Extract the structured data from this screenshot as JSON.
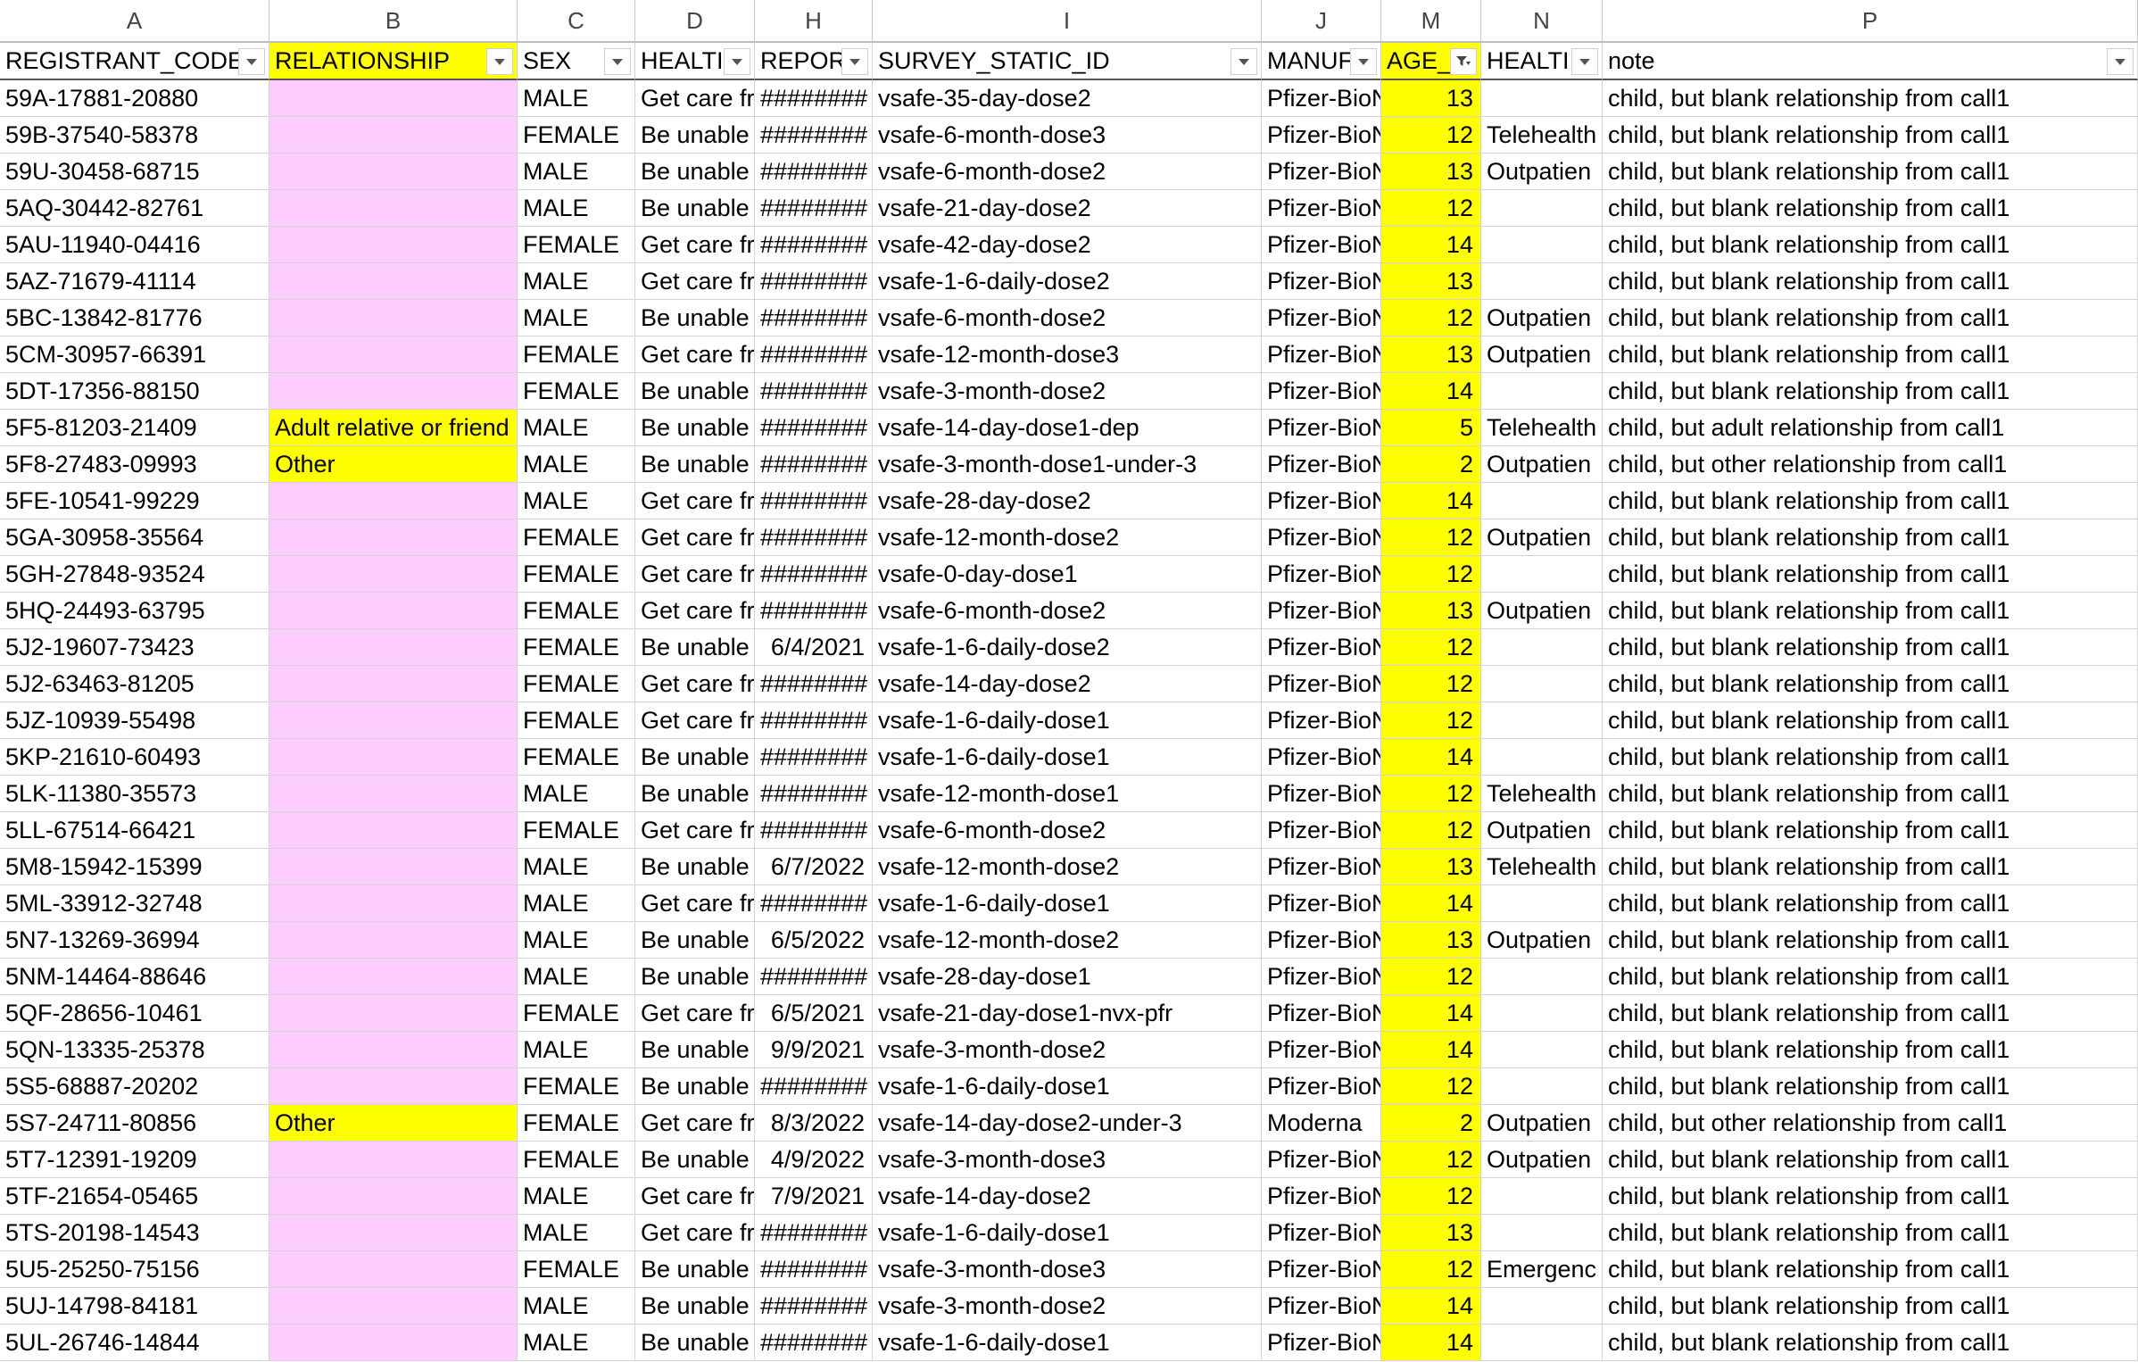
{
  "columns": [
    {
      "letter": "A",
      "header": "REGISTRANT_CODE",
      "width": 302
    },
    {
      "letter": "B",
      "header": "RELATIONSHIP",
      "width": 278
    },
    {
      "letter": "C",
      "header": "SEX",
      "width": 132
    },
    {
      "letter": "D",
      "header": "HEALTI",
      "width": 134
    },
    {
      "letter": "H",
      "header": "REPOR",
      "width": 132
    },
    {
      "letter": "I",
      "header": "SURVEY_STATIC_ID",
      "width": 436
    },
    {
      "letter": "J",
      "header": "MANUF",
      "width": 134
    },
    {
      "letter": "M",
      "header": "AGE_",
      "width": 112
    },
    {
      "letter": "N",
      "header": "HEALTI",
      "width": 136
    },
    {
      "letter": "P",
      "header": "note",
      "width": 600
    }
  ],
  "colors": {
    "relationship_header": "#ffff00",
    "relationship_blank": "#ffccff",
    "relationship_filled": "#ffff00",
    "age_column": "#ffff00",
    "gridline": "#d4d4d4"
  },
  "filter_icons": {
    "default": "dropdown-arrow-icon",
    "active": "filter-active-icon"
  },
  "rows": [
    [
      "59A-17881-20880",
      "",
      "MALE",
      "Get care fr",
      "########",
      "vsafe-35-day-dose2",
      "Pfizer-BioN",
      "13",
      "",
      "child, but blank relationship from call1"
    ],
    [
      "59B-37540-58378",
      "",
      "FEMALE",
      "Be unable",
      "########",
      "vsafe-6-month-dose3",
      "Pfizer-BioN",
      "12",
      "Telehealth",
      "child, but blank relationship from call1"
    ],
    [
      "59U-30458-68715",
      "",
      "MALE",
      "Be unable",
      "########",
      "vsafe-6-month-dose2",
      "Pfizer-BioN",
      "13",
      "Outpatien",
      "child, but blank relationship from call1"
    ],
    [
      "5AQ-30442-82761",
      "",
      "MALE",
      "Be unable",
      "########",
      "vsafe-21-day-dose2",
      "Pfizer-BioN",
      "12",
      "",
      "child, but blank relationship from call1"
    ],
    [
      "5AU-11940-04416",
      "",
      "FEMALE",
      "Get care fr",
      "########",
      "vsafe-42-day-dose2",
      "Pfizer-BioN",
      "14",
      "",
      "child, but blank relationship from call1"
    ],
    [
      "5AZ-71679-41114",
      "",
      "MALE",
      "Get care fr",
      "########",
      "vsafe-1-6-daily-dose2",
      "Pfizer-BioN",
      "13",
      "",
      "child, but blank relationship from call1"
    ],
    [
      "5BC-13842-81776",
      "",
      "MALE",
      "Be unable",
      "########",
      "vsafe-6-month-dose2",
      "Pfizer-BioN",
      "12",
      "Outpatien",
      "child, but blank relationship from call1"
    ],
    [
      "5CM-30957-66391",
      "",
      "FEMALE",
      "Get care fr",
      "########",
      "vsafe-12-month-dose3",
      "Pfizer-BioN",
      "13",
      "Outpatien",
      "child, but blank relationship from call1"
    ],
    [
      "5DT-17356-88150",
      "",
      "FEMALE",
      "Be unable",
      "########",
      "vsafe-3-month-dose2",
      "Pfizer-BioN",
      "14",
      "",
      "child, but blank relationship from call1"
    ],
    [
      "5F5-81203-21409",
      "Adult relative or friend",
      "MALE",
      "Be unable",
      "########",
      "vsafe-14-day-dose1-dep",
      "Pfizer-BioN",
      "5",
      "Telehealth",
      "child, but adult relationship from call1"
    ],
    [
      "5F8-27483-09993",
      "Other",
      "MALE",
      "Be unable",
      "########",
      "vsafe-3-month-dose1-under-3",
      "Pfizer-BioN",
      "2",
      "Outpatien",
      "child, but other relationship from call1"
    ],
    [
      "5FE-10541-99229",
      "",
      "MALE",
      "Get care fr",
      "########",
      "vsafe-28-day-dose2",
      "Pfizer-BioN",
      "14",
      "",
      "child, but blank relationship from call1"
    ],
    [
      "5GA-30958-35564",
      "",
      "FEMALE",
      "Get care fr",
      "########",
      "vsafe-12-month-dose2",
      "Pfizer-BioN",
      "12",
      "Outpatien",
      "child, but blank relationship from call1"
    ],
    [
      "5GH-27848-93524",
      "",
      "FEMALE",
      "Get care fr",
      "########",
      "vsafe-0-day-dose1",
      "Pfizer-BioN",
      "12",
      "",
      "child, but blank relationship from call1"
    ],
    [
      "5HQ-24493-63795",
      "",
      "FEMALE",
      "Get care fr",
      "########",
      "vsafe-6-month-dose2",
      "Pfizer-BioN",
      "13",
      "Outpatien",
      "child, but blank relationship from call1"
    ],
    [
      "5J2-19607-73423",
      "",
      "FEMALE",
      "Be unable",
      "6/4/2021",
      "vsafe-1-6-daily-dose2",
      "Pfizer-BioN",
      "12",
      "",
      "child, but blank relationship from call1"
    ],
    [
      "5J2-63463-81205",
      "",
      "FEMALE",
      "Get care fr",
      "########",
      "vsafe-14-day-dose2",
      "Pfizer-BioN",
      "12",
      "",
      "child, but blank relationship from call1"
    ],
    [
      "5JZ-10939-55498",
      "",
      "FEMALE",
      "Get care fr",
      "########",
      "vsafe-1-6-daily-dose1",
      "Pfizer-BioN",
      "12",
      "",
      "child, but blank relationship from call1"
    ],
    [
      "5KP-21610-60493",
      "",
      "FEMALE",
      "Be unable",
      "########",
      "vsafe-1-6-daily-dose1",
      "Pfizer-BioN",
      "14",
      "",
      "child, but blank relationship from call1"
    ],
    [
      "5LK-11380-35573",
      "",
      "MALE",
      "Be unable",
      "########",
      "vsafe-12-month-dose1",
      "Pfizer-BioN",
      "12",
      "Telehealth",
      "child, but blank relationship from call1"
    ],
    [
      "5LL-67514-66421",
      "",
      "FEMALE",
      "Get care fr",
      "########",
      "vsafe-6-month-dose2",
      "Pfizer-BioN",
      "12",
      "Outpatien",
      "child, but blank relationship from call1"
    ],
    [
      "5M8-15942-15399",
      "",
      "MALE",
      "Be unable",
      "6/7/2022",
      "vsafe-12-month-dose2",
      "Pfizer-BioN",
      "13",
      "Telehealth",
      "child, but blank relationship from call1"
    ],
    [
      "5ML-33912-32748",
      "",
      "MALE",
      "Get care fr",
      "########",
      "vsafe-1-6-daily-dose1",
      "Pfizer-BioN",
      "14",
      "",
      "child, but blank relationship from call1"
    ],
    [
      "5N7-13269-36994",
      "",
      "MALE",
      "Be unable",
      "6/5/2022",
      "vsafe-12-month-dose2",
      "Pfizer-BioN",
      "13",
      "Outpatien",
      "child, but blank relationship from call1"
    ],
    [
      "5NM-14464-88646",
      "",
      "MALE",
      "Be unable",
      "########",
      "vsafe-28-day-dose1",
      "Pfizer-BioN",
      "12",
      "",
      "child, but blank relationship from call1"
    ],
    [
      "5QF-28656-10461",
      "",
      "FEMALE",
      "Get care fr",
      "6/5/2021",
      "vsafe-21-day-dose1-nvx-pfr",
      "Pfizer-BioN",
      "14",
      "",
      "child, but blank relationship from call1"
    ],
    [
      "5QN-13335-25378",
      "",
      "MALE",
      "Be unable",
      "9/9/2021",
      "vsafe-3-month-dose2",
      "Pfizer-BioN",
      "14",
      "",
      "child, but blank relationship from call1"
    ],
    [
      "5S5-68887-20202",
      "",
      "FEMALE",
      "Be unable",
      "########",
      "vsafe-1-6-daily-dose1",
      "Pfizer-BioN",
      "12",
      "",
      "child, but blank relationship from call1"
    ],
    [
      "5S7-24711-80856",
      "Other",
      "FEMALE",
      "Get care fr",
      "8/3/2022",
      "vsafe-14-day-dose2-under-3",
      "Moderna",
      "2",
      "Outpatien",
      "child, but other relationship from call1"
    ],
    [
      "5T7-12391-19209",
      "",
      "FEMALE",
      "Be unable",
      "4/9/2022",
      "vsafe-3-month-dose3",
      "Pfizer-BioN",
      "12",
      "Outpatien",
      "child, but blank relationship from call1"
    ],
    [
      "5TF-21654-05465",
      "",
      "MALE",
      "Get care fr",
      "7/9/2021",
      "vsafe-14-day-dose2",
      "Pfizer-BioN",
      "12",
      "",
      "child, but blank relationship from call1"
    ],
    [
      "5TS-20198-14543",
      "",
      "MALE",
      "Get care fr",
      "########",
      "vsafe-1-6-daily-dose1",
      "Pfizer-BioN",
      "13",
      "",
      "child, but blank relationship from call1"
    ],
    [
      "5U5-25250-75156",
      "",
      "FEMALE",
      "Be unable",
      "########",
      "vsafe-3-month-dose3",
      "Pfizer-BioN",
      "12",
      "Emergenc",
      "child, but blank relationship from call1"
    ],
    [
      "5UJ-14798-84181",
      "",
      "MALE",
      "Be unable",
      "########",
      "vsafe-3-month-dose2",
      "Pfizer-BioN",
      "14",
      "",
      "child, but blank relationship from call1"
    ],
    [
      "5UL-26746-14844",
      "",
      "MALE",
      "Be unable",
      "########",
      "vsafe-1-6-daily-dose1",
      "Pfizer-BioN",
      "14",
      "",
      "child, but blank relationship from call1"
    ]
  ]
}
